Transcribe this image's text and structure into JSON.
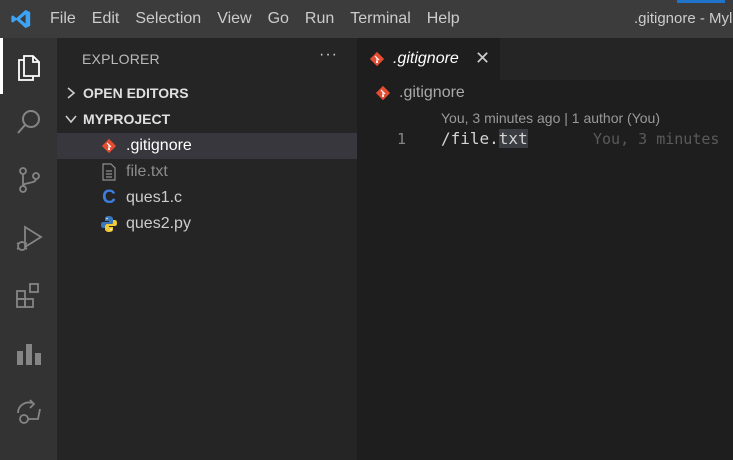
{
  "titlebar": {
    "app_icon": "vscode-logo",
    "menu": [
      "File",
      "Edit",
      "Selection",
      "View",
      "Go",
      "Run",
      "Terminal",
      "Help"
    ],
    "window_title": ".gitignore - Myl"
  },
  "activity_bar": {
    "icons": [
      "files-icon",
      "search-icon",
      "source-control-icon",
      "run-debug-icon",
      "extensions-icon",
      "chart-icon",
      "remote-icon"
    ],
    "active": "files-icon"
  },
  "sidebar": {
    "title": "EXPLORER",
    "more": "···",
    "open_editors": "OPEN EDITORS",
    "project": "MYPROJECT",
    "files": [
      {
        "name": ".gitignore",
        "icon": "git-icon",
        "selected": true
      },
      {
        "name": "file.txt",
        "icon": "text-file-icon",
        "ignored": true
      },
      {
        "name": "ques1.c",
        "icon": "c-lang-icon"
      },
      {
        "name": "ques2.py",
        "icon": "python-icon"
      }
    ]
  },
  "editor": {
    "tab": {
      "label": ".gitignore",
      "close": "✕"
    },
    "breadcrumb": ".gitignore",
    "codelens": "You, 3 minutes ago | 1 author (You)",
    "line_number": "1",
    "code_prefix": "/file.",
    "code_highlight": "txt",
    "blame": "You, 3 minutes"
  },
  "colors": {
    "titlebar": "#3c3c3c",
    "activity_bar": "#333333",
    "sidebar": "#252526",
    "editor": "#1e1e1e",
    "selected_row": "#37373d",
    "git_orange": "#e44d32"
  }
}
